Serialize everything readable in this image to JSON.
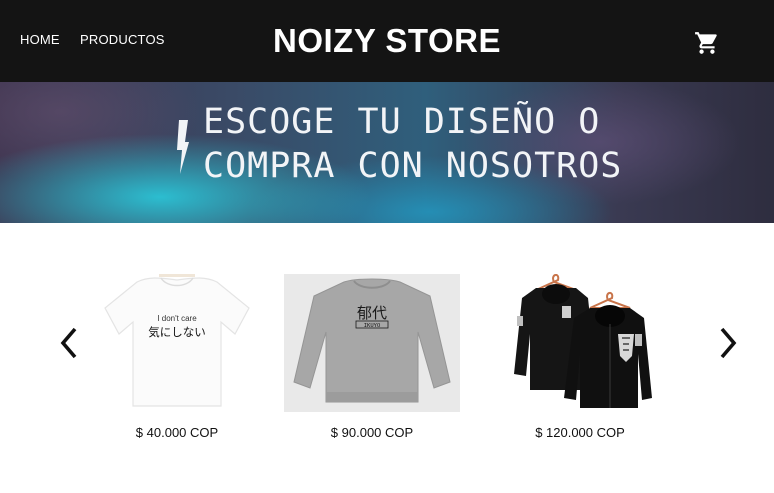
{
  "nav": {
    "home_label": "HOME",
    "products_label": "PRODUCTOS",
    "brand": "NOIZY STORE",
    "cart_icon": "shopping-cart-icon"
  },
  "hero": {
    "line1": "ESCOGE TU DISEÑO O",
    "line2": "COMPRA CON NOSOTROS",
    "icon": "lightning-bolt-icon"
  },
  "carousel": {
    "prev_icon": "chevron-left-icon",
    "next_icon": "chevron-right-icon",
    "products": [
      {
        "image_text_line1": "I don't care",
        "image_text_line2": "気にしない",
        "price": "$ 40.000 COP"
      },
      {
        "image_text_line1": "郁代",
        "image_text_line2": "IKUYO",
        "price": "$ 90.000 COP"
      },
      {
        "price": "$ 120.000 COP"
      }
    ]
  },
  "colors": {
    "header_bg": "#141414",
    "header_text": "#ffffff",
    "hero_accent": "#2bc4d6",
    "text": "#111111"
  }
}
